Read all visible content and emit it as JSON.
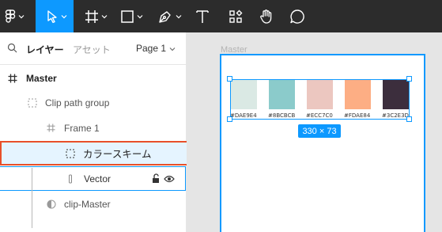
{
  "toolbar": {
    "tools": [
      {
        "name": "figma-menu",
        "icon": "figma-logo-icon",
        "has_dropdown": true
      },
      {
        "name": "move",
        "icon": "cursor-arrow-icon",
        "has_dropdown": true,
        "active": true
      },
      {
        "name": "frame",
        "icon": "hash-frame-icon",
        "has_dropdown": true
      },
      {
        "name": "shape",
        "icon": "rectangle-icon",
        "has_dropdown": true
      },
      {
        "name": "pen",
        "icon": "pen-icon",
        "has_dropdown": true
      },
      {
        "name": "text",
        "icon": "text-t-icon",
        "has_dropdown": false
      },
      {
        "name": "resources",
        "icon": "resources-icon",
        "has_dropdown": false
      },
      {
        "name": "hand",
        "icon": "hand-icon",
        "has_dropdown": false
      },
      {
        "name": "comment",
        "icon": "comment-bubble-icon",
        "has_dropdown": false
      }
    ],
    "active_color": "#0d99ff",
    "background": "#2c2c2c"
  },
  "left_panel": {
    "tabs": {
      "layers": "レイヤー",
      "assets": "アセット",
      "page": "Page 1"
    },
    "layers": [
      {
        "label": "Master",
        "icon": "frame-hash-icon",
        "depth": 0
      },
      {
        "label": "Clip path group",
        "icon": "dashed-group-icon",
        "depth": 1
      },
      {
        "label": "Frame 1",
        "icon": "frame-hash-icon",
        "depth": 2
      },
      {
        "label": "カラースキーム",
        "icon": "dashed-group-icon",
        "depth": 3,
        "selected": true,
        "highlighted": true
      },
      {
        "label": "Vector",
        "icon": "vector-line-icon",
        "depth": 3,
        "hover": true,
        "locked": false,
        "visible": true
      },
      {
        "label": "clip-Master",
        "icon": "half-circle-mask-icon",
        "depth": 2
      }
    ]
  },
  "canvas": {
    "frame_label": "Master",
    "size_badge": "330 × 73",
    "swatches": [
      {
        "hex": "#DAE9E4",
        "label": "#DAE9E4"
      },
      {
        "hex": "#8BCBCB",
        "label": "#8BCBCB"
      },
      {
        "hex": "#ECC7C0",
        "label": "#ECC7C0"
      },
      {
        "hex": "#FDAE84",
        "label": "#FDAE84"
      },
      {
        "hex": "#3C2E3D",
        "label": "#3C2E3D"
      }
    ],
    "selection_color": "#0d99ff"
  },
  "annotation_color": "#e8502a"
}
